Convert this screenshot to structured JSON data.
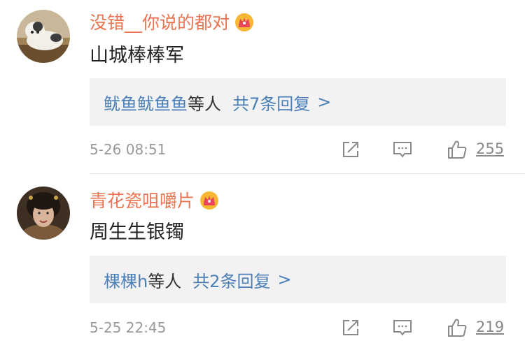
{
  "comments": [
    {
      "username": "没错__你说的都对",
      "text": "山城棒棒军",
      "replies": {
        "names": "鱿鱼鱿鱼鱼",
        "suffix": "等人",
        "count": "共7条回复",
        "arrow": ">"
      },
      "timestamp": "5-26 08:51",
      "likes": "255"
    },
    {
      "username": "青花瓷咀嚼片",
      "text": "周生生银镯",
      "replies": {
        "names": "棵棵h",
        "suffix": "等人",
        "count": "共2条回复",
        "arrow": ">"
      },
      "timestamp": "5-25 22:45",
      "likes": "219"
    }
  ],
  "icons": {
    "badge": "crown-badge-icon",
    "share": "share-icon",
    "comment": "comment-icon",
    "like": "like-icon"
  },
  "colors": {
    "username": "#eb7350",
    "link": "#4a7fb8",
    "reply_bg": "#f2f2f2",
    "meta": "#999999"
  }
}
